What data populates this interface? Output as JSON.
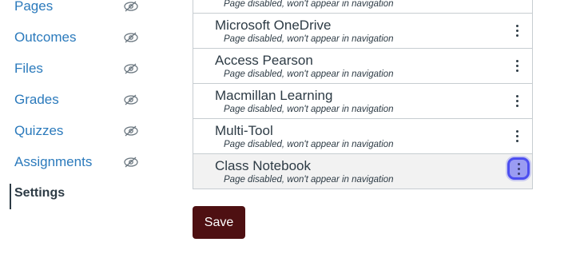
{
  "nav": {
    "items": [
      {
        "label": "Pages",
        "hidden": true
      },
      {
        "label": "Outcomes",
        "hidden": true
      },
      {
        "label": "Files",
        "hidden": true
      },
      {
        "label": "Grades",
        "hidden": true
      },
      {
        "label": "Quizzes",
        "hidden": true
      },
      {
        "label": "Assignments",
        "hidden": true
      },
      {
        "label": "Settings",
        "hidden": false,
        "active": true
      }
    ],
    "icon": "eye-slash-icon"
  },
  "disabled_list": {
    "items": [
      {
        "title": "",
        "subtitle": "Page disabled, won't appear in navigation"
      },
      {
        "title": "Microsoft OneDrive",
        "subtitle": "Page disabled, won't appear in navigation"
      },
      {
        "title": "Access Pearson",
        "subtitle": "Page disabled, won't appear in navigation"
      },
      {
        "title": "Macmillan Learning",
        "subtitle": "Page disabled, won't appear in navigation"
      },
      {
        "title": "Multi-Tool",
        "subtitle": "Page disabled, won't appear in navigation"
      },
      {
        "title": "Class Notebook",
        "subtitle": "Page disabled, won't appear in navigation"
      }
    ],
    "menu_icon": "kebab-menu-icon"
  },
  "save_button": {
    "label": "Save"
  },
  "colors": {
    "link": "#2b7abc",
    "text": "#2d3b45",
    "border": "#c7cdd1",
    "save_bg": "#4e1012",
    "focus_ring": "#4c4ef0"
  }
}
